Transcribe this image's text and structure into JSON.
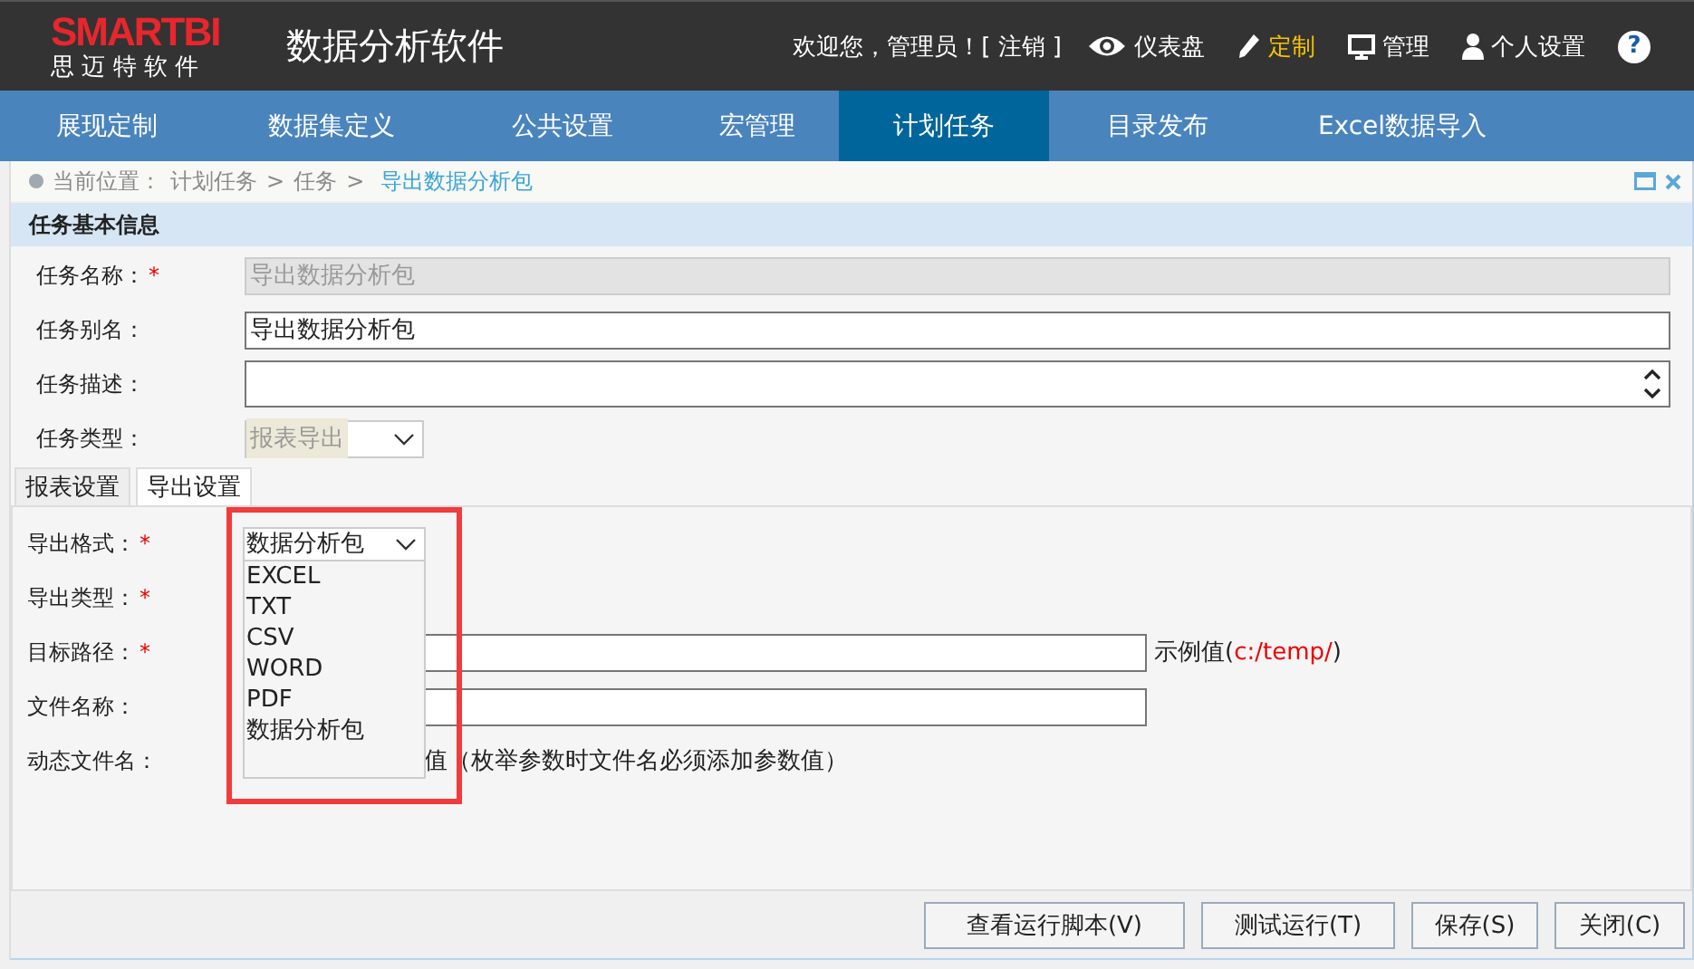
{
  "header": {
    "logo": "SMARTBI",
    "logo_subtitle": "思 迈 特 软 件",
    "title": "数据分析软件",
    "welcome": "欢迎您，管理员！",
    "logout": "[ 注销 ]",
    "links": [
      {
        "label": "仪表盘",
        "selected": false
      },
      {
        "label": "定制",
        "selected": true
      },
      {
        "label": "管理",
        "selected": false
      },
      {
        "label": "个人设置",
        "selected": false
      }
    ],
    "help": "?"
  },
  "nav": [
    {
      "label": "展现定制",
      "selected": false
    },
    {
      "label": "数据集定义",
      "selected": false
    },
    {
      "label": "公共设置",
      "selected": false
    },
    {
      "label": "宏管理",
      "selected": false
    },
    {
      "label": "计划任务",
      "selected": true
    },
    {
      "label": "目录发布",
      "selected": false
    },
    {
      "label": "Excel数据导入",
      "selected": false
    }
  ],
  "breadcrumb": [
    {
      "text": "当前位置：",
      "kind": "label"
    },
    {
      "text": "计划任务",
      "kind": "link"
    },
    {
      "text": ">",
      "kind": "sep"
    },
    {
      "text": "任务",
      "kind": "link"
    },
    {
      "text": ">",
      "kind": "sep"
    },
    {
      "text": "导出数据分析包",
      "kind": "current"
    }
  ],
  "section_title": "任务基本信息",
  "basic_fields": [
    {
      "label": "任务名称：",
      "required_mark": "*",
      "kind": "text",
      "value": "导出数据分析包",
      "disabled": true
    },
    {
      "label": "任务别名：",
      "kind": "text",
      "value": "导出数据分析包",
      "disabled": false
    },
    {
      "label": "任务描述：",
      "kind": "textarea",
      "disabled": false
    },
    {
      "label": "任务类型：",
      "kind": "select",
      "value": "报表导出",
      "disabled": true
    }
  ],
  "sub_tabs": [
    {
      "label": "报表设置",
      "selected": false
    },
    {
      "label": "导出设置",
      "selected": true
    }
  ],
  "export_fields": [
    {
      "label": "导出格式：",
      "required_mark": "*",
      "kind": "select",
      "value": "数据分析包",
      "open": true,
      "options": [
        "EXCEL",
        "TXT",
        "CSV",
        "WORD",
        "PDF",
        "数据分析包"
      ]
    },
    {
      "label": "导出类型：",
      "required_mark": "*",
      "kind": "none"
    },
    {
      "label": "目标路径：",
      "required_mark": "*",
      "kind": "text",
      "hint": "示例值(",
      "hint_example": "c:/temp/",
      "hint_end": ")"
    },
    {
      "label": "文件名称：",
      "kind": "text"
    },
    {
      "label": "动态文件名：",
      "kind": "note",
      "note": "值（枚举参数时文件名必须添加参数值）"
    }
  ],
  "buttons": [
    "查看运行脚本(V)",
    "测试运行(T)",
    "保存(S)",
    "关闭(C)"
  ]
}
